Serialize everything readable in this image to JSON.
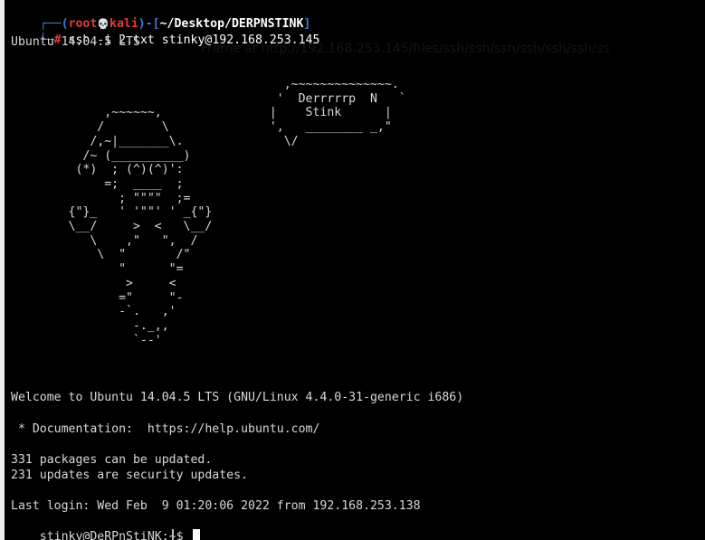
{
  "prompt": {
    "corner_top": "┌──(",
    "user": "root",
    "skull": "💀",
    "host": "kali",
    "close_user": ")-[",
    "path": "~/Desktop/DERPNSTINK",
    "close_path": "]",
    "corner_bottom": "└─",
    "symbol": "#",
    "command": " ssh -i 2.txt stinky@192.168.253.145"
  },
  "ghost_text": "Frame at http://192.168.253.145/files/ssh/ssh/ssh/ssh/ssh/ssh/ss",
  "output": {
    "ubuntu_version": "Ubuntu 14.04.5 LTS",
    "ascii_art": "                                      ,~~~~~~~~~~~~~~.\n                                     '  Derrrrrp  N   `\n             ,~~~~~~,               |    Stink      |\n            /        \\              ',   ________ _,\"\n           /,~|_______\\.              \\/\n          /~ (__________)\n         (*)  ; (^)(^)':\n             =;  ____  ;\n               ; \"\"\"\"  ;=\n        {\"}_   ' '\"\"' ' _{\"}\n        \\__/     >  <   \\__/\n           \\    ,\"   \",  /\n            \\  \"       /\"\n               \"      \"=\n                >     <\n               =\"     \"-\n               -`.   ,'\n                 -._,,\n                 `--'",
    "welcome": "Welcome to Ubuntu 14.04.5 LTS (GNU/Linux 4.4.0-31-generic i686)",
    "documentation": " * Documentation:  https://help.ubuntu.com/",
    "packages": "331 packages can be updated.",
    "security": "231 updates are security updates.",
    "last_login": "Last login: Wed Feb  9 01:20:06 2022 from 192.168.253.138",
    "shell_prompt": "stinky@DeRPnStiNK:~$ "
  },
  "colors": {
    "background": "#000000",
    "text": "#d8d8d8",
    "prompt_blue": "#3b7dd8",
    "prompt_red": "#e03b3b"
  }
}
